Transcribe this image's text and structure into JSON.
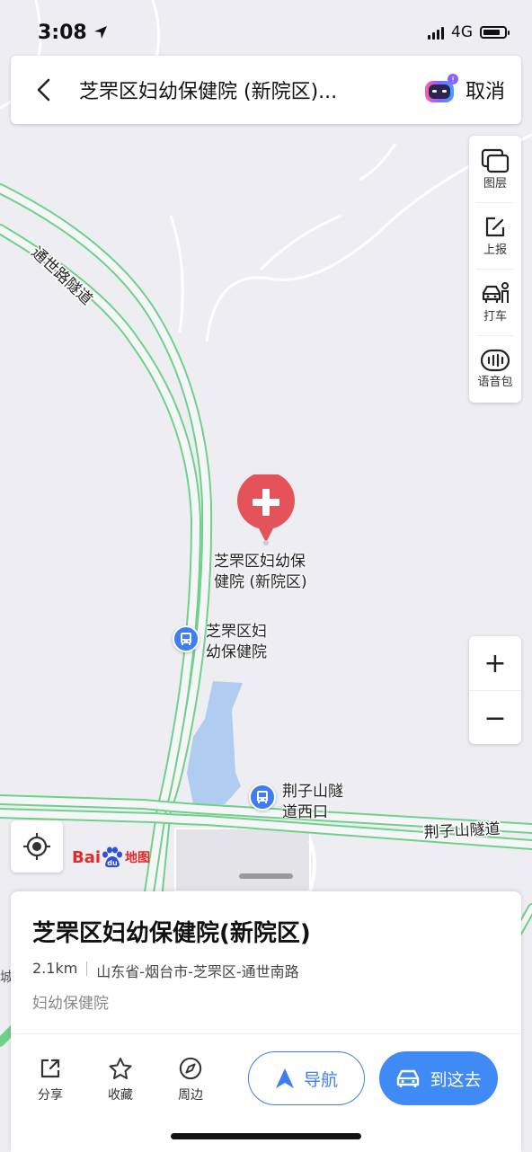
{
  "status": {
    "time": "3:08",
    "network": "4G"
  },
  "search": {
    "title": "芝罘区妇幼保健院 (新院区)...",
    "cancel": "取消"
  },
  "toolbar": {
    "layers": "图层",
    "report": "上报",
    "taxi": "打车",
    "voice": "语音包"
  },
  "zoom": {
    "in": "+",
    "out": "−"
  },
  "map": {
    "road_tongshi": "通世路隧道",
    "road_jingzi": "荆子山隧道",
    "hospital_line1": "芝罘区妇幼保",
    "hospital_line2": "健院 (新院区)",
    "bus1_line1": "芝罘区妇",
    "bus1_line2": "幼保健院",
    "bus2_line1": "荆子山隧",
    "bus2_line2": "道西口",
    "edge_char": "城"
  },
  "logo": {
    "bai": "Bai",
    "du": "du",
    "ditu": "地图"
  },
  "place": {
    "title": "芝罘区妇幼保健院(新院区)",
    "distance": "2.1km",
    "address": "山东省-烟台市-芝罘区-通世南路",
    "category": "妇幼保健院"
  },
  "actions": {
    "share": "分享",
    "favorite": "收藏",
    "nearby": "周边",
    "navigate": "导航",
    "go": "到这去"
  },
  "colors": {
    "accent": "#3f7ef2",
    "road": "#6fd08a",
    "pin": "#e5535a",
    "water": "#a9c8ef"
  }
}
